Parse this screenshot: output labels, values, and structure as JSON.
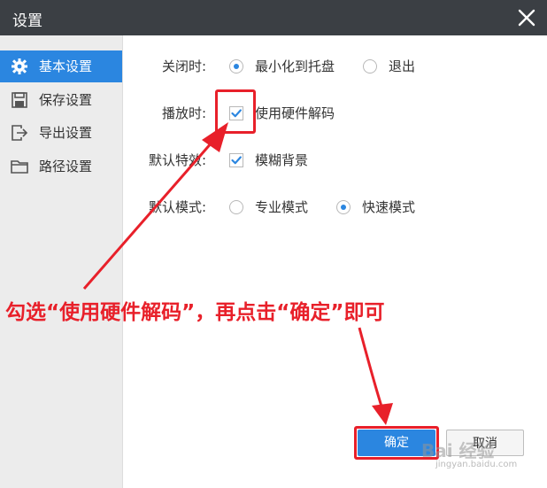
{
  "window": {
    "title": "设置"
  },
  "sidebar": {
    "items": [
      {
        "label": "基本设置",
        "icon": "gear-icon",
        "active": true
      },
      {
        "label": "保存设置",
        "icon": "save-icon",
        "active": false
      },
      {
        "label": "导出设置",
        "icon": "export-icon",
        "active": false
      },
      {
        "label": "路径设置",
        "icon": "folder-icon",
        "active": false
      }
    ]
  },
  "settings": {
    "close_label": "关闭时:",
    "close_options": [
      {
        "label": "最小化到托盘",
        "selected": true
      },
      {
        "label": "退出",
        "selected": false
      }
    ],
    "play_label": "播放时:",
    "play_option": {
      "label": "使用硬件解码",
      "checked": true
    },
    "effect_label": "默认特效:",
    "effect_option": {
      "label": "模糊背景",
      "checked": true
    },
    "mode_label": "默认模式:",
    "mode_options": [
      {
        "label": "专业模式",
        "selected": false
      },
      {
        "label": "快速模式",
        "selected": true
      }
    ]
  },
  "annotation": {
    "instruction": "勾选“使用硬件解码”，再点击“确定”即可",
    "color": "#e8202a"
  },
  "buttons": {
    "ok": "确定",
    "cancel": "取消"
  },
  "watermark": {
    "text": "Bai 经验",
    "sub": "jingyan.baidu.com"
  },
  "colors": {
    "accent": "#2b86e0",
    "titlebar": "#3b3f44",
    "sidebar": "#ececec"
  }
}
